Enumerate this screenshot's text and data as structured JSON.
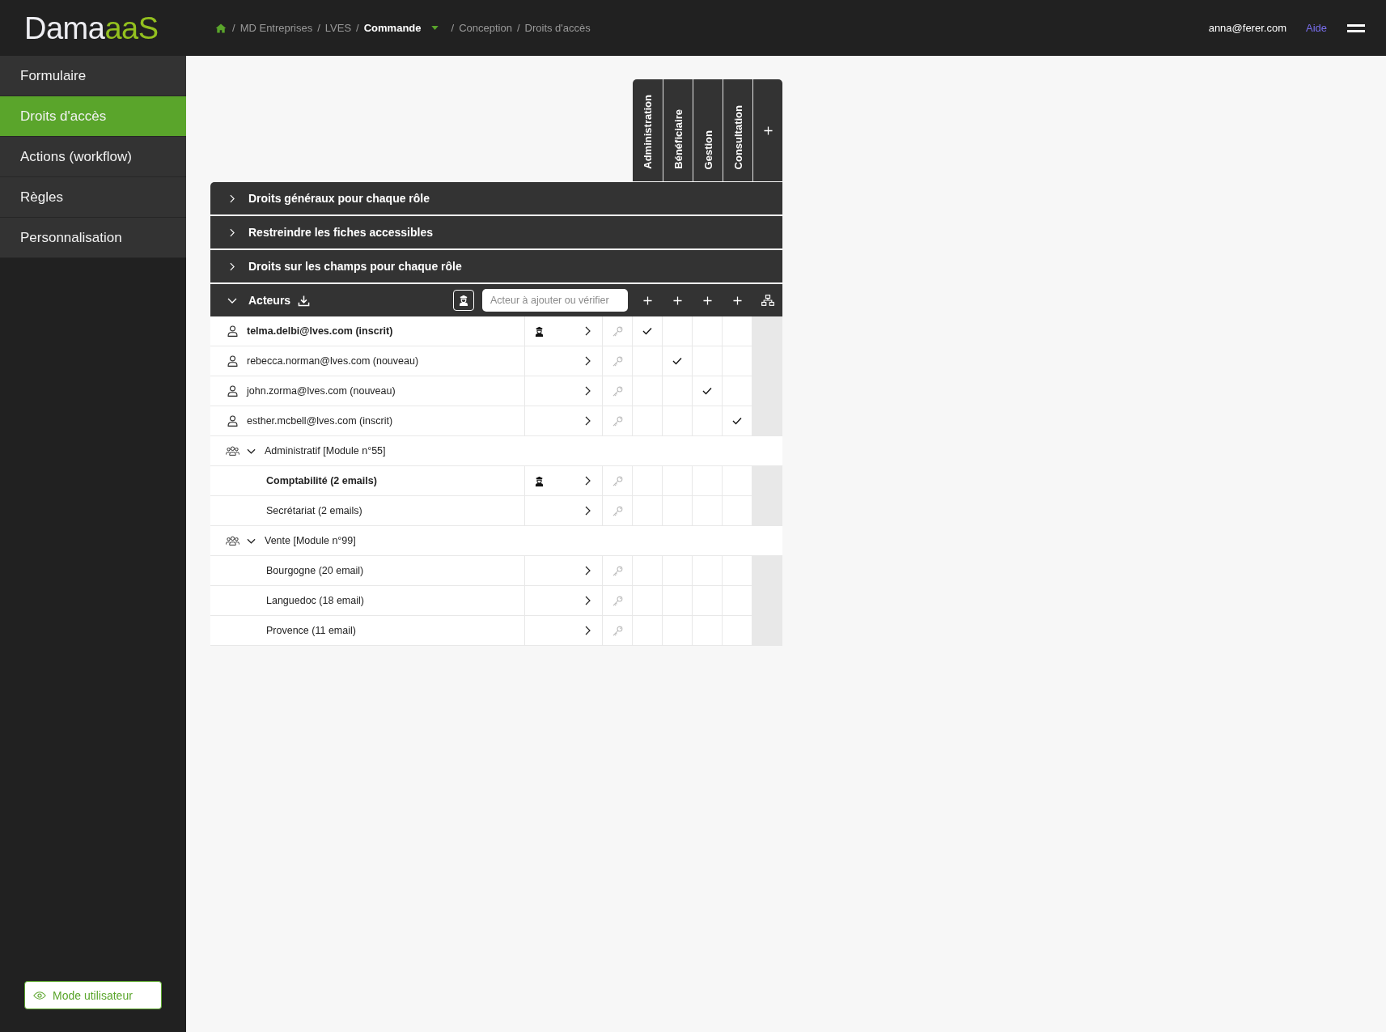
{
  "header": {
    "logo": {
      "text": "Dama",
      "accent": "aaS"
    },
    "breadcrumb": [
      {
        "separator": "/",
        "label": "MD Entreprises",
        "current": false,
        "dropdown": false
      },
      {
        "separator": "/",
        "label": "LVES",
        "current": false,
        "dropdown": false
      },
      {
        "separator": "/",
        "label": "Commande",
        "current": true,
        "dropdown": true
      },
      {
        "separator": "/",
        "label": "Conception",
        "current": false,
        "dropdown": false
      },
      {
        "separator": "/",
        "label": "Droits d'accès",
        "current": false,
        "dropdown": false
      }
    ],
    "user": "anna@ferer.com",
    "help": "Aide"
  },
  "sidebar": {
    "items": [
      {
        "label": "Formulaire",
        "selected": false
      },
      {
        "label": "Droits d'accès",
        "selected": true
      },
      {
        "label": "Actions (workflow)",
        "selected": false
      },
      {
        "label": "Règles",
        "selected": false
      },
      {
        "label": "Personnalisation",
        "selected": false
      }
    ],
    "mode_button": "Mode utilisateur"
  },
  "roles": [
    "Administration",
    "Bénéficiaire",
    "Gestion",
    "Consultation"
  ],
  "sections": [
    {
      "title": "Droits généraux pour chaque rôle",
      "expanded": false
    },
    {
      "title": "Restreindre les fiches accessibles",
      "expanded": false
    },
    {
      "title": "Droits sur les champs pour chaque rôle",
      "expanded": false
    }
  ],
  "actors": {
    "title": "Acteurs",
    "expanded": true,
    "search": {
      "placeholder": "Acteur à ajouter ou vérifier"
    },
    "rows": [
      {
        "kind": "person",
        "label": "telma.delbi@lves.com (inscrit)",
        "manager": true,
        "checks": [
          true,
          false,
          false,
          false
        ]
      },
      {
        "kind": "person",
        "label": "rebecca.norman@lves.com (nouveau)",
        "manager": false,
        "checks": [
          false,
          true,
          false,
          false
        ]
      },
      {
        "kind": "person",
        "label": "john.zorma@lves.com (nouveau)",
        "manager": false,
        "checks": [
          false,
          false,
          true,
          false
        ]
      },
      {
        "kind": "person",
        "label": "esther.mcbell@lves.com (inscrit)",
        "manager": false,
        "checks": [
          false,
          false,
          false,
          true
        ]
      },
      {
        "kind": "group",
        "label": "Administratif [Module n°55]",
        "expanded": true,
        "children": [
          {
            "kind": "member",
            "label": "Comptabilité (2 emails)",
            "manager": true,
            "checks": [
              false,
              false,
              false,
              false
            ]
          },
          {
            "kind": "member",
            "label": "Secrétariat (2 emails)",
            "manager": false,
            "checks": [
              false,
              false,
              false,
              false
            ]
          }
        ]
      },
      {
        "kind": "group",
        "label": "Vente [Module n°99]",
        "expanded": true,
        "children": [
          {
            "kind": "member",
            "label": "Bourgogne (20 email)",
            "manager": false,
            "checks": [
              false,
              false,
              false,
              false
            ]
          },
          {
            "kind": "member",
            "label": "Languedoc (18 email)",
            "manager": false,
            "checks": [
              false,
              false,
              false,
              false
            ]
          },
          {
            "kind": "member",
            "label": "Provence (11 email)",
            "manager": false,
            "checks": [
              false,
              false,
              false,
              false
            ]
          }
        ]
      }
    ]
  }
}
